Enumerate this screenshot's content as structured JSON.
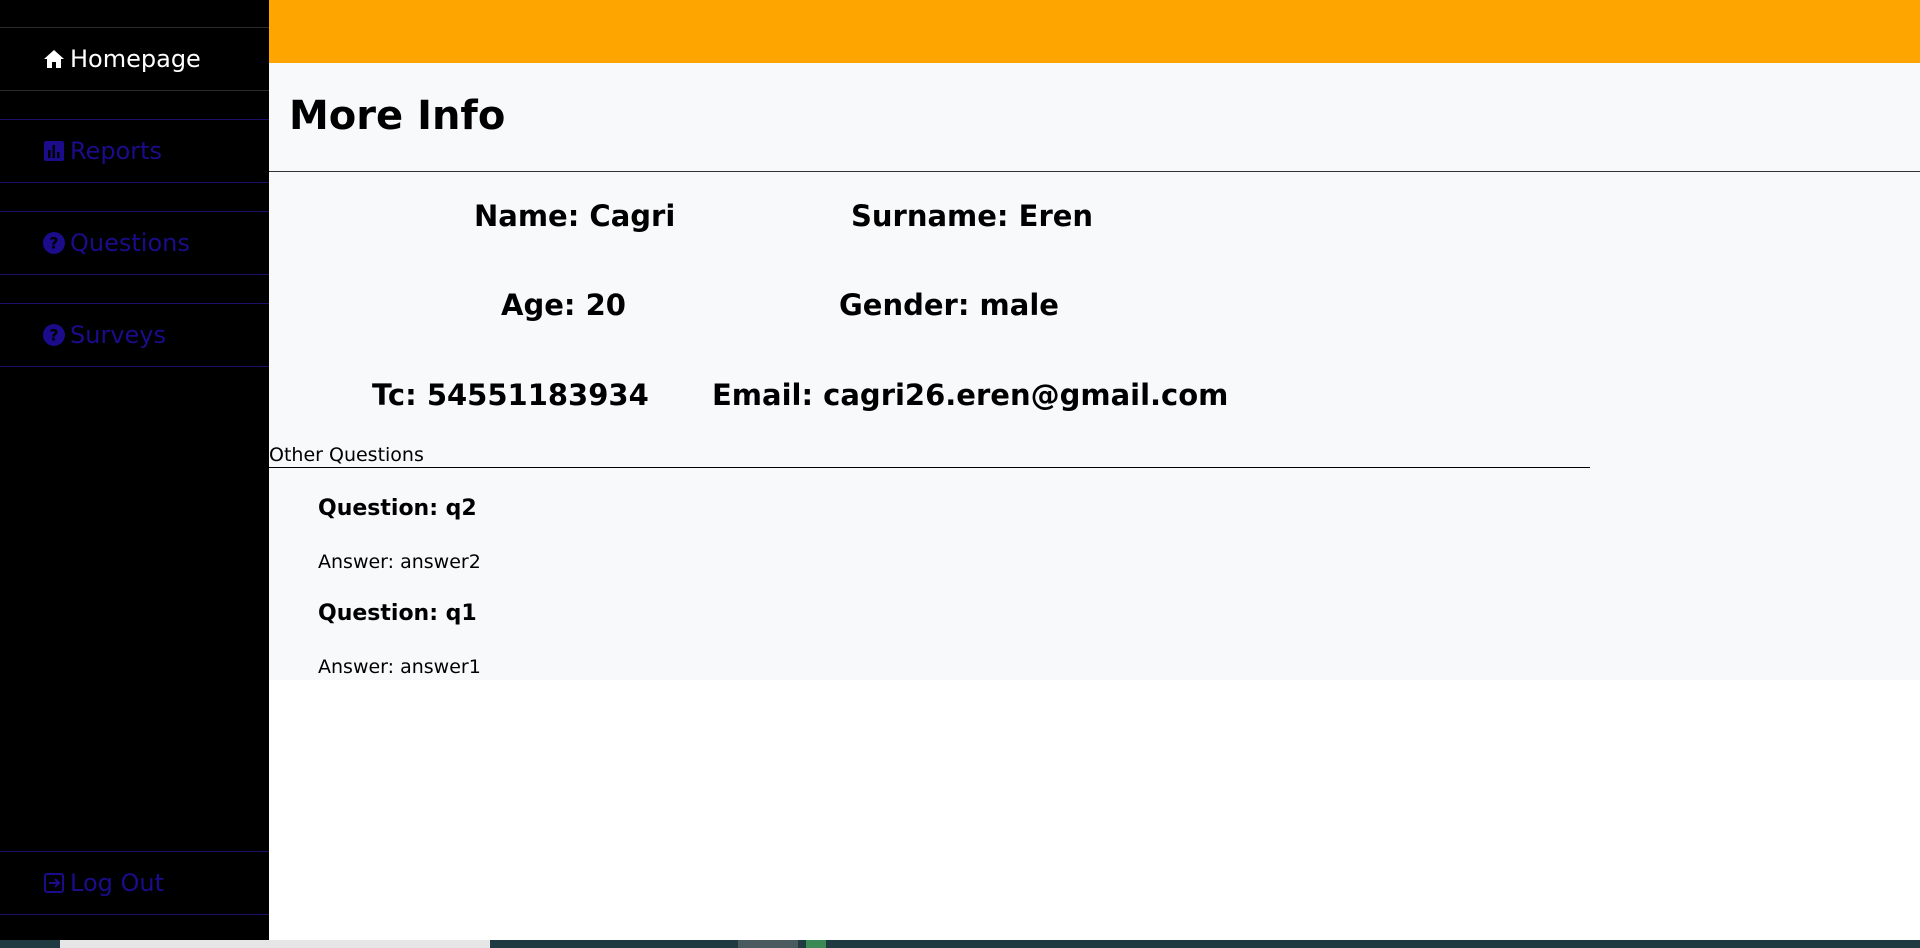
{
  "sidebar": {
    "items": [
      {
        "label": "Homepage",
        "icon": "home-icon"
      },
      {
        "label": "Reports",
        "icon": "bar-chart-icon"
      },
      {
        "label": "Questions",
        "icon": "question-circle-icon"
      },
      {
        "label": "Surveys",
        "icon": "question-circle-icon"
      }
    ],
    "logout": {
      "label": "Log Out",
      "icon": "logout-icon"
    }
  },
  "colors": {
    "topbar": "#ffa500",
    "sidebar": "#000000",
    "nav_inactive_text": "#1a0c8a",
    "nav_active_text": "#ffffff",
    "main_bg": "#f8f9fb"
  },
  "main": {
    "title": "More Info",
    "name": "Name: Cagri",
    "surname": "Surname: Eren",
    "age": "Age: 20",
    "gender": "Gender: male",
    "tc": "Tc: 54551183934",
    "email": "Email: cagri26.eren@gmail.com",
    "other_questions_label": "Other Questions",
    "qa": [
      {
        "question": "Question: q2",
        "answer": "Answer: answer2"
      },
      {
        "question": "Question: q1",
        "answer": "Answer: answer1"
      }
    ]
  }
}
